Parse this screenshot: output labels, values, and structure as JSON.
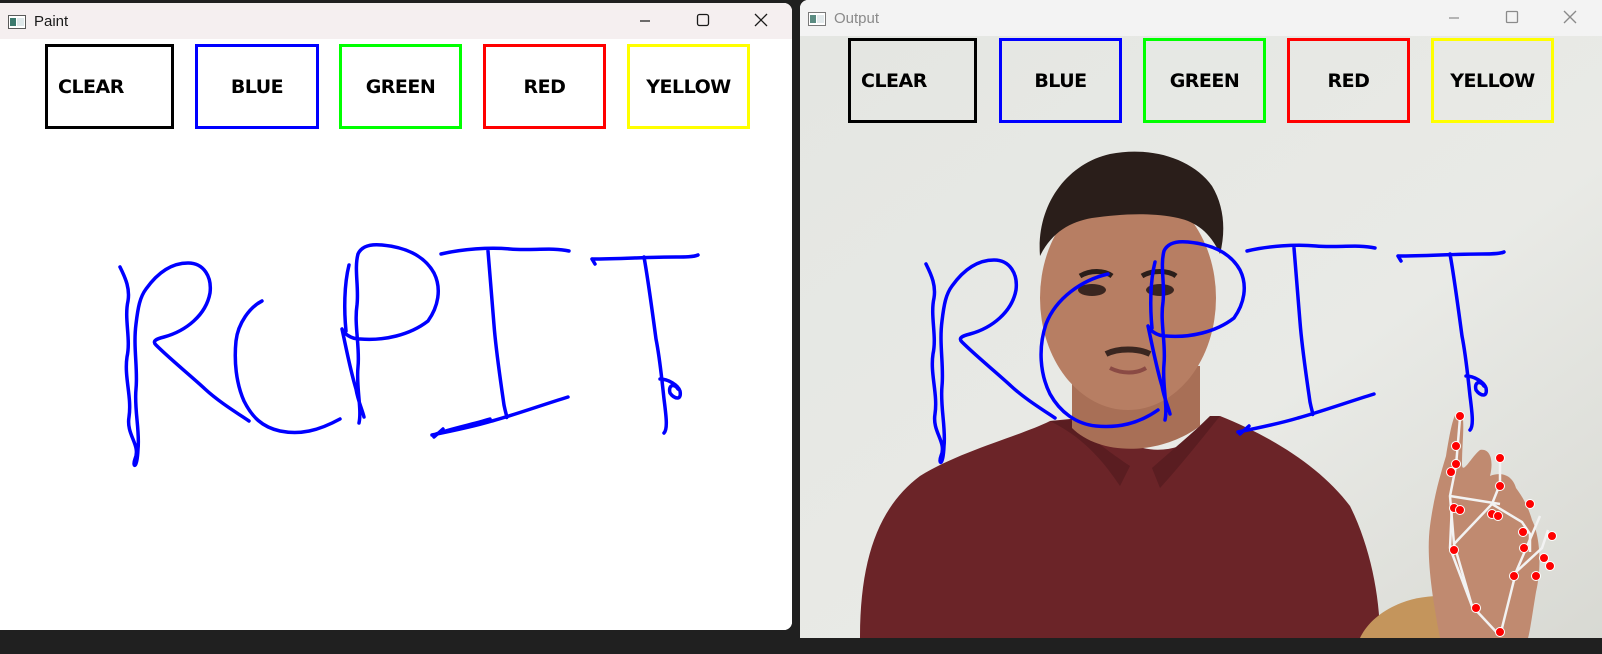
{
  "paint_window": {
    "title": "Paint",
    "controls": {
      "minimize": "minimize",
      "maximize": "maximize",
      "close": "close"
    }
  },
  "output_window": {
    "title": "Output",
    "controls": {
      "minimize": "minimize",
      "maximize": "maximize",
      "close": "close"
    }
  },
  "color_buttons": [
    {
      "label": "CLEAR",
      "color": "#000000"
    },
    {
      "label": "BLUE",
      "color": "#0000ff"
    },
    {
      "label": "GREEN",
      "color": "#00ff00"
    },
    {
      "label": "RED",
      "color": "#ff0000"
    },
    {
      "label": "YELLOW",
      "color": "#ffff00"
    }
  ],
  "drawing": {
    "stroke_color": "#0000ff",
    "landmark_color": "#ff0000",
    "skeleton_color": "#f2f2f2"
  },
  "scene": {
    "wall_color": "#e6e7e3",
    "shirt_color": "#6b2428",
    "skin_color": "#b77e63",
    "hair_color": "#2a1e1a"
  }
}
